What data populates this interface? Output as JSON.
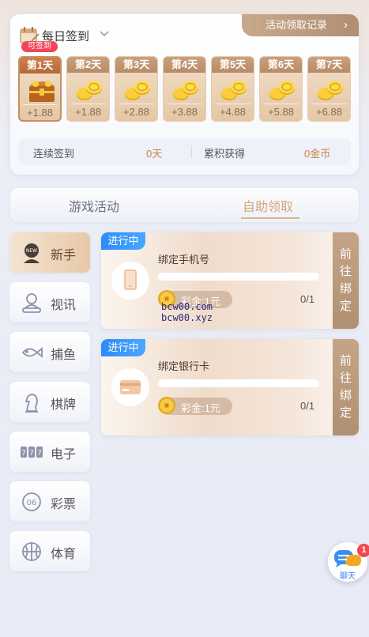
{
  "signin": {
    "title": "每日签到",
    "record_link": "活动领取记录",
    "badge": "可签到",
    "days": [
      {
        "label": "第1天",
        "value": "+1.88",
        "icon": "treasure-chest-icon"
      },
      {
        "label": "第2天",
        "value": "+1.88",
        "icon": "gold-coins-icon"
      },
      {
        "label": "第3天",
        "value": "+2.88",
        "icon": "gold-coins-icon"
      },
      {
        "label": "第4天",
        "value": "+3.88",
        "icon": "gold-coins-icon"
      },
      {
        "label": "第5天",
        "value": "+4.88",
        "icon": "gold-coins-icon"
      },
      {
        "label": "第6天",
        "value": "+5.88",
        "icon": "gold-coins-icon"
      },
      {
        "label": "第7天",
        "value": "+6.88",
        "icon": "gold-coins-icon"
      }
    ],
    "streak_label": "连续签到",
    "streak_value": "0天",
    "total_label": "累积获得",
    "total_value": "0金币"
  },
  "tabs": {
    "games": "游戏活动",
    "self_claim": "自助领取"
  },
  "sidebar": {
    "items": [
      {
        "label": "新手",
        "icon": "new-badge-icon"
      },
      {
        "label": "视讯",
        "icon": "live-dealer-icon"
      },
      {
        "label": "捕鱼",
        "icon": "fish-icon"
      },
      {
        "label": "棋牌",
        "icon": "chess-knight-icon"
      },
      {
        "label": "电子",
        "icon": "slot-777-icon"
      },
      {
        "label": "彩票",
        "icon": "lottery-ball-icon"
      },
      {
        "label": "体育",
        "icon": "basketball-icon"
      }
    ]
  },
  "tasks": [
    {
      "status": "进行中",
      "title": "绑定手机号",
      "reward": "彩金:1元",
      "count": "0/1",
      "action": "前往绑定",
      "progress": 0,
      "icon": "phone-icon"
    },
    {
      "status": "进行中",
      "title": "绑定银行卡",
      "reward": "彩金:1元",
      "count": "0/1",
      "action": "前往绑定",
      "progress": 0,
      "icon": "bank-card-icon"
    }
  ],
  "watermark": {
    "line1": "bcw00.com",
    "line2": "bcw00.xyz"
  },
  "chat": {
    "label": "聊天",
    "badge": "1"
  },
  "colors": {
    "accent": "#d4a677",
    "status_blue": "#2c8cf5",
    "badge_red": "#f0465a",
    "stat_orange": "#c8843d"
  }
}
